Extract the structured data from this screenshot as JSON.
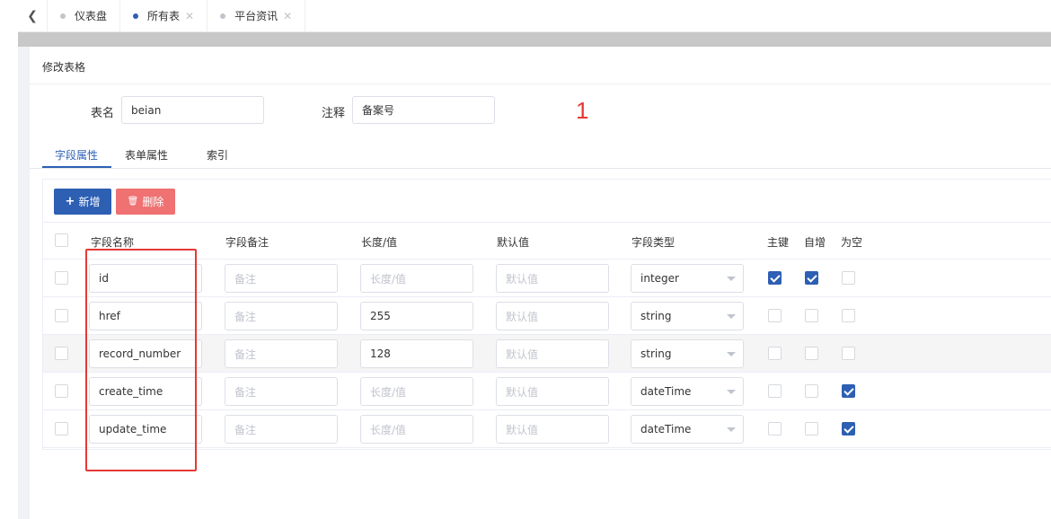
{
  "tabbar": {
    "tabs": [
      {
        "label": "仪表盘",
        "closable": false,
        "active": false
      },
      {
        "label": "所有表",
        "closable": true,
        "active": true
      },
      {
        "label": "平台资讯",
        "closable": true,
        "active": false
      }
    ]
  },
  "card": {
    "title": "修改表格",
    "table_name_label": "表名",
    "table_name_value": "beian",
    "comment_label": "注释",
    "comment_value": "备案号",
    "annotation": "1"
  },
  "subtabs": [
    "字段属性",
    "表单属性",
    "索引"
  ],
  "toolbar": {
    "add_label": "新增",
    "delete_label": "删除"
  },
  "table": {
    "headers": {
      "name": "字段名称",
      "remark": "字段备注",
      "length": "长度/值",
      "default": "默认值",
      "type": "字段类型",
      "pk": "主键",
      "auto": "自增",
      "nullable": "为空"
    },
    "placeholders": {
      "remark": "备注",
      "length": "长度/值",
      "default": "默认值"
    },
    "rows": [
      {
        "name": "id",
        "remark": "",
        "length": "",
        "default": "",
        "type": "integer",
        "pk": true,
        "auto": true,
        "nullable": false
      },
      {
        "name": "href",
        "remark": "",
        "length": "255",
        "default": "",
        "type": "string",
        "pk": false,
        "auto": false,
        "nullable": false
      },
      {
        "name": "record_number",
        "remark": "",
        "length": "128",
        "default": "",
        "type": "string",
        "pk": false,
        "auto": false,
        "nullable": false
      },
      {
        "name": "create_time",
        "remark": "",
        "length": "",
        "default": "",
        "type": "dateTime",
        "pk": false,
        "auto": false,
        "nullable": true
      },
      {
        "name": "update_time",
        "remark": "",
        "length": "",
        "default": "",
        "type": "dateTime",
        "pk": false,
        "auto": false,
        "nullable": true
      }
    ]
  },
  "colors": {
    "primary": "#2d5fb3",
    "danger": "#ef7171",
    "annotation": "#e53935"
  }
}
